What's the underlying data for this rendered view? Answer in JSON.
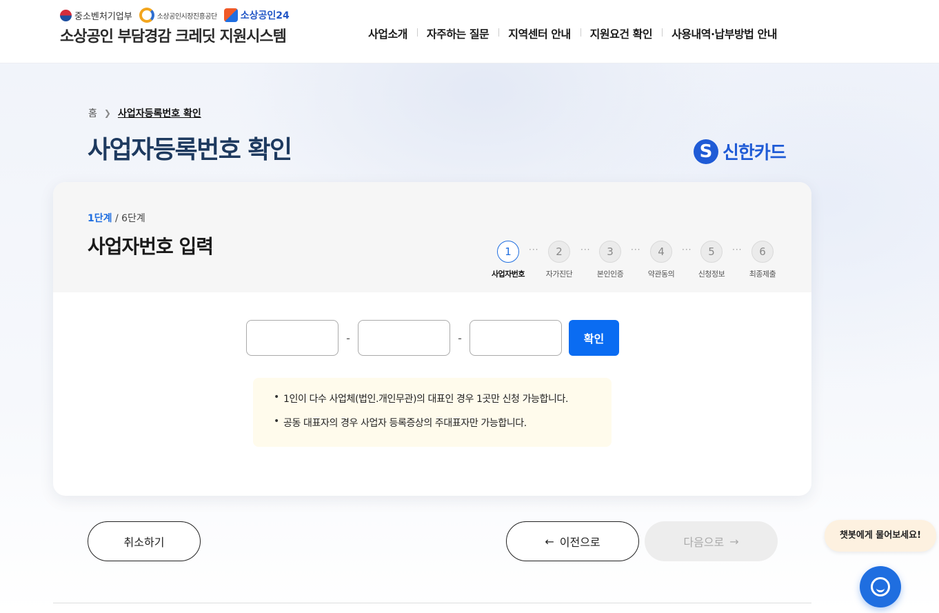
{
  "header": {
    "logos": [
      "중소벤처기업부",
      "소상공인시장진흥공단",
      "소상공인24"
    ],
    "site_title": "소상공인 부담경감 크레딧 지원시스템",
    "nav": [
      "사업소개",
      "자주하는 질문",
      "지역센터 안내",
      "지원요건 확인",
      "사용내역·납부방법 안내"
    ]
  },
  "breadcrumb": {
    "home": "홈",
    "current": "사업자등록번호 확인"
  },
  "page_title": "사업자등록번호 확인",
  "partner": {
    "name": "신한카드",
    "mark": "S"
  },
  "card": {
    "step_current": "1단계",
    "step_total": " / 6단계",
    "title": "사업자번호 입력",
    "steps": [
      {
        "num": "1",
        "label": "사업자번호",
        "active": true
      },
      {
        "num": "2",
        "label": "자가진단",
        "active": false
      },
      {
        "num": "3",
        "label": "본인인증",
        "active": false
      },
      {
        "num": "4",
        "label": "약관동의",
        "active": false
      },
      {
        "num": "5",
        "label": "신청정보",
        "active": false
      },
      {
        "num": "6",
        "label": "최종제출",
        "active": false
      }
    ],
    "inputs": {
      "part1": "",
      "part2": "",
      "part3": "",
      "separator": "-"
    },
    "confirm_label": "확인",
    "notices": [
      "1인이 다수 사업체(법인.개인무관)의 대표인 경우 1곳만 신청 가능합니다.",
      "공동 대표자의 경우 사업자 등록증상의 주대표자만 가능합니다."
    ]
  },
  "buttons": {
    "cancel": "취소하기",
    "prev": "이전으로",
    "next": "다음으로"
  },
  "chat": {
    "bubble": "챗봇에게 물어보세요!"
  },
  "colors": {
    "primary": "#0a6cf2",
    "title": "#1e3a5f",
    "shinhan": "#1f5bd6",
    "notice_bg": "#fffbec"
  }
}
